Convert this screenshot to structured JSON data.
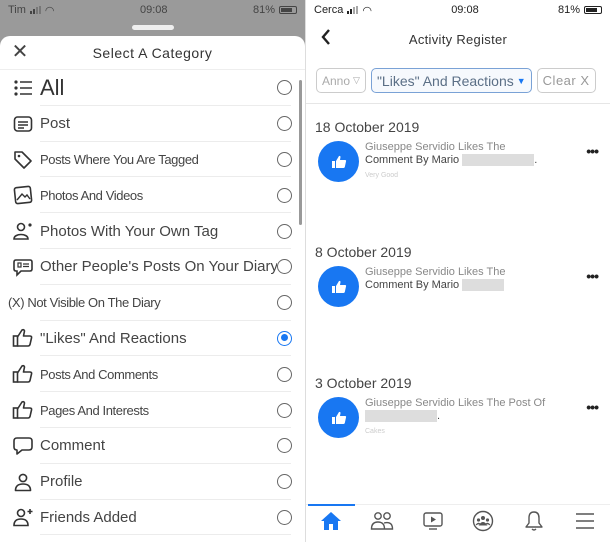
{
  "left": {
    "status": {
      "carrier": "Tim",
      "time": "09:08",
      "battery": "81%"
    },
    "sheet_title": "Select A Category",
    "categories": [
      {
        "icon": "list-icon",
        "label": "All",
        "selected": false
      },
      {
        "icon": "post-icon",
        "label": "Post",
        "selected": false
      },
      {
        "icon": "tag-icon",
        "label": "Posts Where You Are Tagged",
        "selected": false
      },
      {
        "icon": "photo-icon",
        "label": "Photos And Videos",
        "selected": false
      },
      {
        "icon": "person-tag-icon",
        "label": "Photos With Your Own Tag",
        "selected": false
      },
      {
        "icon": "chat-post-icon",
        "label": "Other People's Posts On Your Diary",
        "selected": false
      },
      {
        "icon": "hidden-icon",
        "label": "(X) Not Visible On The Diary",
        "selected": false
      },
      {
        "icon": "thumbs-up-icon",
        "label": "\"Likes\" And Reactions",
        "selected": true
      },
      {
        "icon": "thumbs-up-icon",
        "label": "Posts And Comments",
        "selected": false
      },
      {
        "icon": "thumbs-up-icon",
        "label": "Pages And Interests",
        "selected": false
      },
      {
        "icon": "comment-icon",
        "label": "Comment",
        "selected": false
      },
      {
        "icon": "profile-icon",
        "label": "Profile",
        "selected": false
      },
      {
        "icon": "friend-add-icon",
        "label": "Friends Added",
        "selected": false
      }
    ]
  },
  "right": {
    "status": {
      "carrier": "Cerca",
      "time": "09:08",
      "battery": "81%"
    },
    "title": "Activity Register",
    "filters": {
      "year": "Anno",
      "category": "\"Likes\" And Reactions",
      "clear": "Clear X"
    },
    "days": [
      {
        "date": "18 October 2019",
        "entries": [
          {
            "line1": "Giuseppe Servidio Likes The",
            "line2": "Comment By Mario",
            "sub": "Very Good"
          }
        ]
      },
      {
        "date": "8 October 2019",
        "entries": [
          {
            "line1": "Giuseppe Servidio Likes The",
            "line2": "Comment By Mario",
            "sub": ""
          }
        ]
      },
      {
        "date": "3 October 2019",
        "entries": [
          {
            "line1": "Giuseppe Servidio Likes The Post Of",
            "line2": "",
            "sub": "Cakes"
          }
        ]
      }
    ],
    "tabs": [
      "home",
      "friends",
      "watch",
      "groups",
      "notifications",
      "menu"
    ],
    "active_tab": "home"
  },
  "colors": {
    "accent": "#1877f2"
  }
}
